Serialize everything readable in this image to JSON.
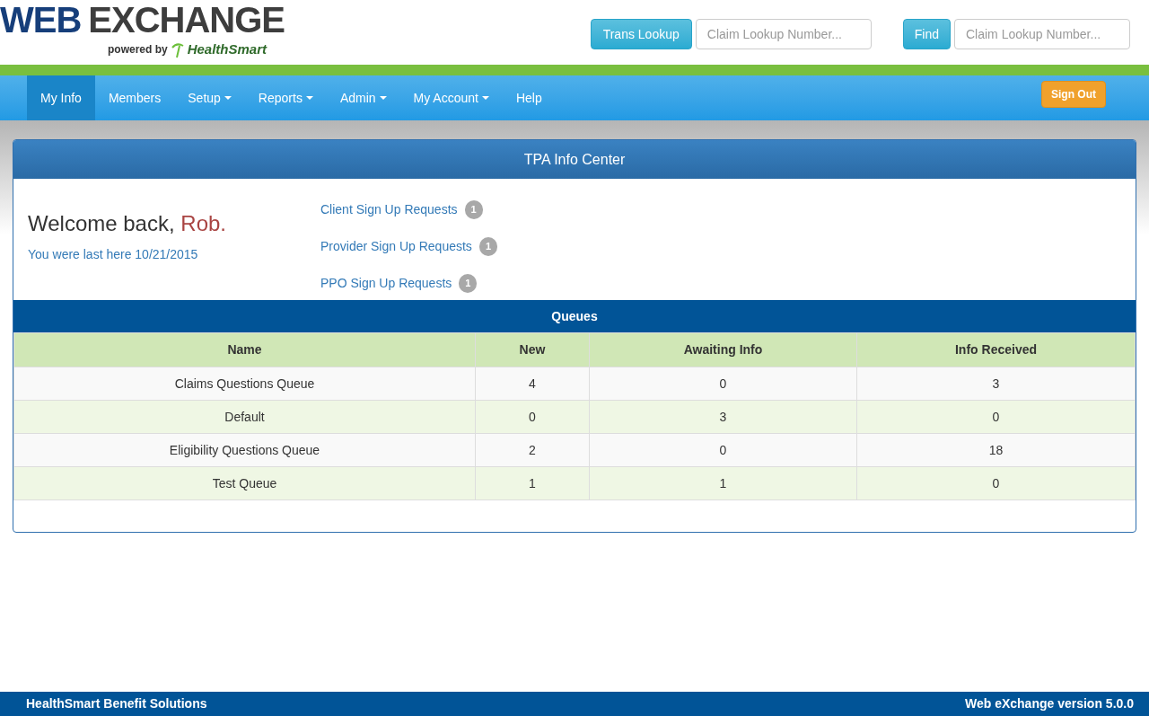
{
  "logo": {
    "word_1": "WEB",
    "word_2": "EXCHANGE",
    "tagline": "powered by",
    "brand": "HealthSmart"
  },
  "header": {
    "lookup_button": "Trans Lookup",
    "lookup_placeholder": "Claim Lookup Number...",
    "find_button": "Find",
    "find_placeholder": "Claim Lookup Number..."
  },
  "nav": {
    "items": [
      {
        "label": "My Info",
        "dropdown": false,
        "selected": true
      },
      {
        "label": "Members",
        "dropdown": false,
        "selected": false
      },
      {
        "label": "Setup",
        "dropdown": true,
        "selected": false
      },
      {
        "label": "Reports",
        "dropdown": true,
        "selected": false
      },
      {
        "label": "Admin",
        "dropdown": true,
        "selected": false
      },
      {
        "label": "My Account",
        "dropdown": true,
        "selected": false
      },
      {
        "label": "Help",
        "dropdown": false,
        "selected": false
      }
    ],
    "sign_out": "Sign Out"
  },
  "panel": {
    "title": "TPA Info Center",
    "welcome": "Welcome back,",
    "name": "Rob.",
    "last_here": "You were last here 10/21/2015",
    "requests": [
      {
        "label": "Client Sign Up Requests",
        "count": "1"
      },
      {
        "label": "Provider Sign Up Requests",
        "count": "1"
      },
      {
        "label": "PPO Sign Up Requests",
        "count": "1"
      }
    ]
  },
  "queues": {
    "title": "Queues",
    "columns": [
      "Name",
      "New",
      "Awaiting Info",
      "Info Received"
    ],
    "rows": [
      [
        "Claims Questions Queue",
        "4",
        "0",
        "3"
      ],
      [
        "Default",
        "0",
        "3",
        "0"
      ],
      [
        "Eligibility Questions Queue",
        "2",
        "0",
        "18"
      ],
      [
        "Test Queue",
        "1",
        "1",
        "0"
      ]
    ]
  },
  "footer": {
    "left": "HealthSmart Benefit Solutions",
    "right": "Web eXchange version 5.0.0"
  }
}
